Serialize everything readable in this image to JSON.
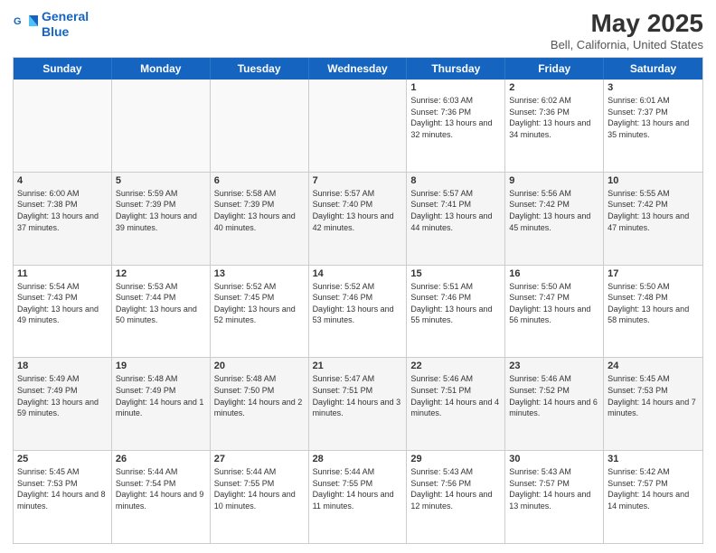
{
  "logo": {
    "line1": "General",
    "line2": "Blue"
  },
  "title": "May 2025",
  "location": "Bell, California, United States",
  "header": {
    "days": [
      "Sunday",
      "Monday",
      "Tuesday",
      "Wednesday",
      "Thursday",
      "Friday",
      "Saturday"
    ]
  },
  "weeks": [
    [
      {
        "day": "",
        "empty": true
      },
      {
        "day": "",
        "empty": true
      },
      {
        "day": "",
        "empty": true
      },
      {
        "day": "",
        "empty": true
      },
      {
        "day": "1",
        "sunrise": "6:03 AM",
        "sunset": "7:36 PM",
        "daylight": "13 hours and 32 minutes."
      },
      {
        "day": "2",
        "sunrise": "6:02 AM",
        "sunset": "7:36 PM",
        "daylight": "13 hours and 34 minutes."
      },
      {
        "day": "3",
        "sunrise": "6:01 AM",
        "sunset": "7:37 PM",
        "daylight": "13 hours and 35 minutes."
      }
    ],
    [
      {
        "day": "4",
        "sunrise": "6:00 AM",
        "sunset": "7:38 PM",
        "daylight": "13 hours and 37 minutes."
      },
      {
        "day": "5",
        "sunrise": "5:59 AM",
        "sunset": "7:39 PM",
        "daylight": "13 hours and 39 minutes."
      },
      {
        "day": "6",
        "sunrise": "5:58 AM",
        "sunset": "7:39 PM",
        "daylight": "13 hours and 40 minutes."
      },
      {
        "day": "7",
        "sunrise": "5:57 AM",
        "sunset": "7:40 PM",
        "daylight": "13 hours and 42 minutes."
      },
      {
        "day": "8",
        "sunrise": "5:57 AM",
        "sunset": "7:41 PM",
        "daylight": "13 hours and 44 minutes."
      },
      {
        "day": "9",
        "sunrise": "5:56 AM",
        "sunset": "7:42 PM",
        "daylight": "13 hours and 45 minutes."
      },
      {
        "day": "10",
        "sunrise": "5:55 AM",
        "sunset": "7:42 PM",
        "daylight": "13 hours and 47 minutes."
      }
    ],
    [
      {
        "day": "11",
        "sunrise": "5:54 AM",
        "sunset": "7:43 PM",
        "daylight": "13 hours and 49 minutes."
      },
      {
        "day": "12",
        "sunrise": "5:53 AM",
        "sunset": "7:44 PM",
        "daylight": "13 hours and 50 minutes."
      },
      {
        "day": "13",
        "sunrise": "5:52 AM",
        "sunset": "7:45 PM",
        "daylight": "13 hours and 52 minutes."
      },
      {
        "day": "14",
        "sunrise": "5:52 AM",
        "sunset": "7:46 PM",
        "daylight": "13 hours and 53 minutes."
      },
      {
        "day": "15",
        "sunrise": "5:51 AM",
        "sunset": "7:46 PM",
        "daylight": "13 hours and 55 minutes."
      },
      {
        "day": "16",
        "sunrise": "5:50 AM",
        "sunset": "7:47 PM",
        "daylight": "13 hours and 56 minutes."
      },
      {
        "day": "17",
        "sunrise": "5:50 AM",
        "sunset": "7:48 PM",
        "daylight": "13 hours and 58 minutes."
      }
    ],
    [
      {
        "day": "18",
        "sunrise": "5:49 AM",
        "sunset": "7:49 PM",
        "daylight": "13 hours and 59 minutes."
      },
      {
        "day": "19",
        "sunrise": "5:48 AM",
        "sunset": "7:49 PM",
        "daylight": "14 hours and 1 minute."
      },
      {
        "day": "20",
        "sunrise": "5:48 AM",
        "sunset": "7:50 PM",
        "daylight": "14 hours and 2 minutes."
      },
      {
        "day": "21",
        "sunrise": "5:47 AM",
        "sunset": "7:51 PM",
        "daylight": "14 hours and 3 minutes."
      },
      {
        "day": "22",
        "sunrise": "5:46 AM",
        "sunset": "7:51 PM",
        "daylight": "14 hours and 4 minutes."
      },
      {
        "day": "23",
        "sunrise": "5:46 AM",
        "sunset": "7:52 PM",
        "daylight": "14 hours and 6 minutes."
      },
      {
        "day": "24",
        "sunrise": "5:45 AM",
        "sunset": "7:53 PM",
        "daylight": "14 hours and 7 minutes."
      }
    ],
    [
      {
        "day": "25",
        "sunrise": "5:45 AM",
        "sunset": "7:53 PM",
        "daylight": "14 hours and 8 minutes."
      },
      {
        "day": "26",
        "sunrise": "5:44 AM",
        "sunset": "7:54 PM",
        "daylight": "14 hours and 9 minutes."
      },
      {
        "day": "27",
        "sunrise": "5:44 AM",
        "sunset": "7:55 PM",
        "daylight": "14 hours and 10 minutes."
      },
      {
        "day": "28",
        "sunrise": "5:44 AM",
        "sunset": "7:55 PM",
        "daylight": "14 hours and 11 minutes."
      },
      {
        "day": "29",
        "sunrise": "5:43 AM",
        "sunset": "7:56 PM",
        "daylight": "14 hours and 12 minutes."
      },
      {
        "day": "30",
        "sunrise": "5:43 AM",
        "sunset": "7:57 PM",
        "daylight": "14 hours and 13 minutes."
      },
      {
        "day": "31",
        "sunrise": "5:42 AM",
        "sunset": "7:57 PM",
        "daylight": "14 hours and 14 minutes."
      }
    ]
  ]
}
